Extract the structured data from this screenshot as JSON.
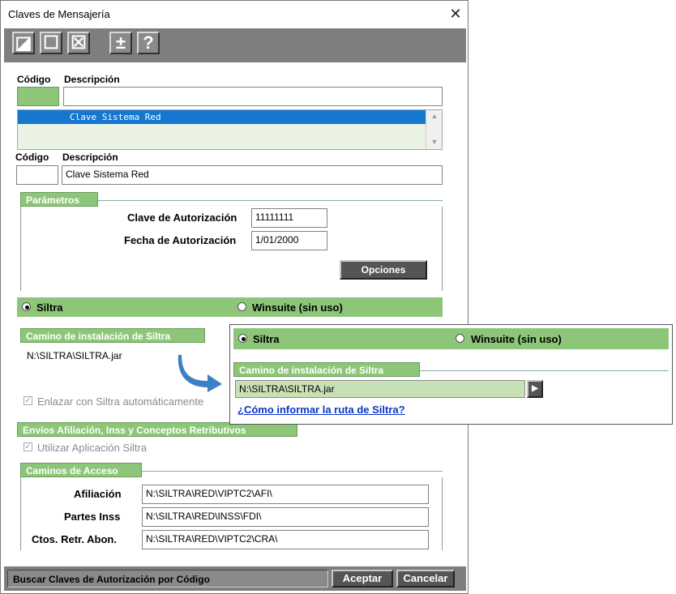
{
  "window": {
    "title": "Claves de Mensajería",
    "close": "✕"
  },
  "toolbar": {
    "btn1": "◪",
    "btn2": "☐",
    "btn3": "☒",
    "btn4": "±",
    "btn5": "?"
  },
  "search": {
    "code_label": "Código",
    "desc_label": "Descripción",
    "code_value": "",
    "desc_value": "",
    "list_items": [
      "Clave Sistema Red"
    ]
  },
  "record": {
    "code_label": "Código",
    "desc_label": "Descripción",
    "code_value": "",
    "desc_value": "Clave Sistema Red"
  },
  "parametros": {
    "title": "Parámetros",
    "clave_label": "Clave de Autorización",
    "clave_value": "11111111",
    "fecha_label": "Fecha de Autorización",
    "fecha_value": "1/01/2000",
    "opciones": "Opciones"
  },
  "radio": {
    "siltra": "Siltra",
    "winsuite": "Winsuite (sin uso)",
    "selected": "siltra"
  },
  "camino": {
    "title": "Camino de instalación de Siltra",
    "value": "N:\\SILTRA\\SILTRA.jar",
    "enlazar": "Enlazar con Siltra automáticamente"
  },
  "envios": {
    "title": "Envíos Afiliación, Inss y Conceptos Retributivos",
    "utilizar": "Utilizar Aplicación Siltra"
  },
  "caminos": {
    "title": "Caminos de Acceso",
    "rows": [
      {
        "label": "Afiliación",
        "value": "N:\\SILTRA\\RED\\VIPTC2\\AFI\\"
      },
      {
        "label": "Partes Inss",
        "value": "N:\\SILTRA\\RED\\INSS\\FDI\\"
      },
      {
        "label": "Ctos. Retr. Abon.",
        "value": "N:\\SILTRA\\RED\\VIPTC2\\CRA\\"
      }
    ]
  },
  "status": {
    "text": "Buscar Claves de Autorización por Código",
    "aceptar": "Aceptar",
    "cancelar": "Cancelar"
  },
  "popup": {
    "siltra": "Siltra",
    "winsuite": "Winsuite (sin uso)",
    "title": "Camino de instalación de Siltra",
    "value": "N:\\SILTRA\\SILTRA.jar",
    "browse": "▶",
    "link": "¿Cómo informar la ruta de Siltra?"
  },
  "colors": {
    "green": "#8dc679",
    "selection": "#1577d0",
    "arrow": "#3b7fc4"
  }
}
